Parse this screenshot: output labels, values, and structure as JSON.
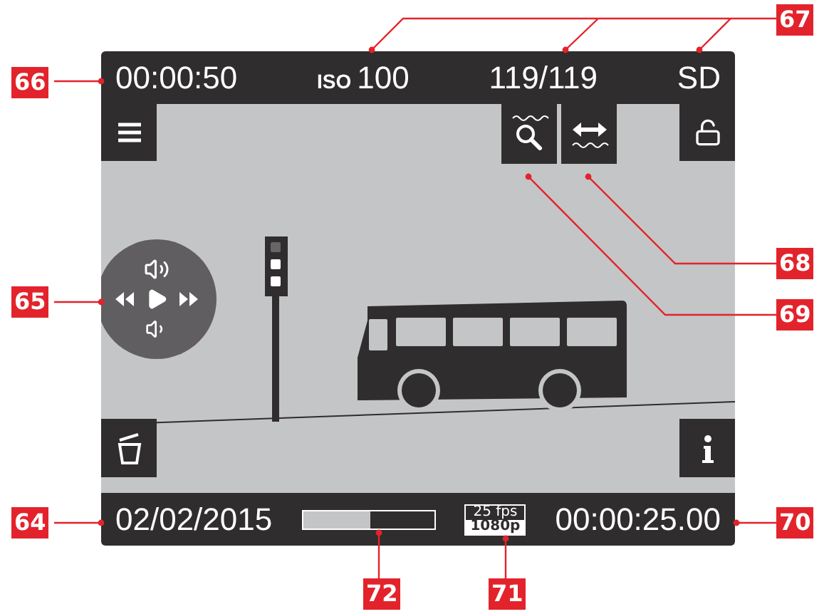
{
  "top_bar": {
    "clock": "00:00:50",
    "iso_label": "ISO",
    "iso_value": "100",
    "frames": "119/119",
    "storage": "SD"
  },
  "bottom_bar": {
    "date": "02/02/2015",
    "progress": {
      "level": 0.52
    },
    "fps": "25 fps",
    "resolution": "1080p",
    "timecode": "00:00:25.00"
  },
  "callouts": [
    {
      "label": "66"
    },
    {
      "label": "67"
    },
    {
      "label": "68"
    },
    {
      "label": "69"
    },
    {
      "label": "65"
    },
    {
      "label": "64"
    },
    {
      "label": "70"
    },
    {
      "label": "72"
    },
    {
      "label": "71"
    }
  ]
}
